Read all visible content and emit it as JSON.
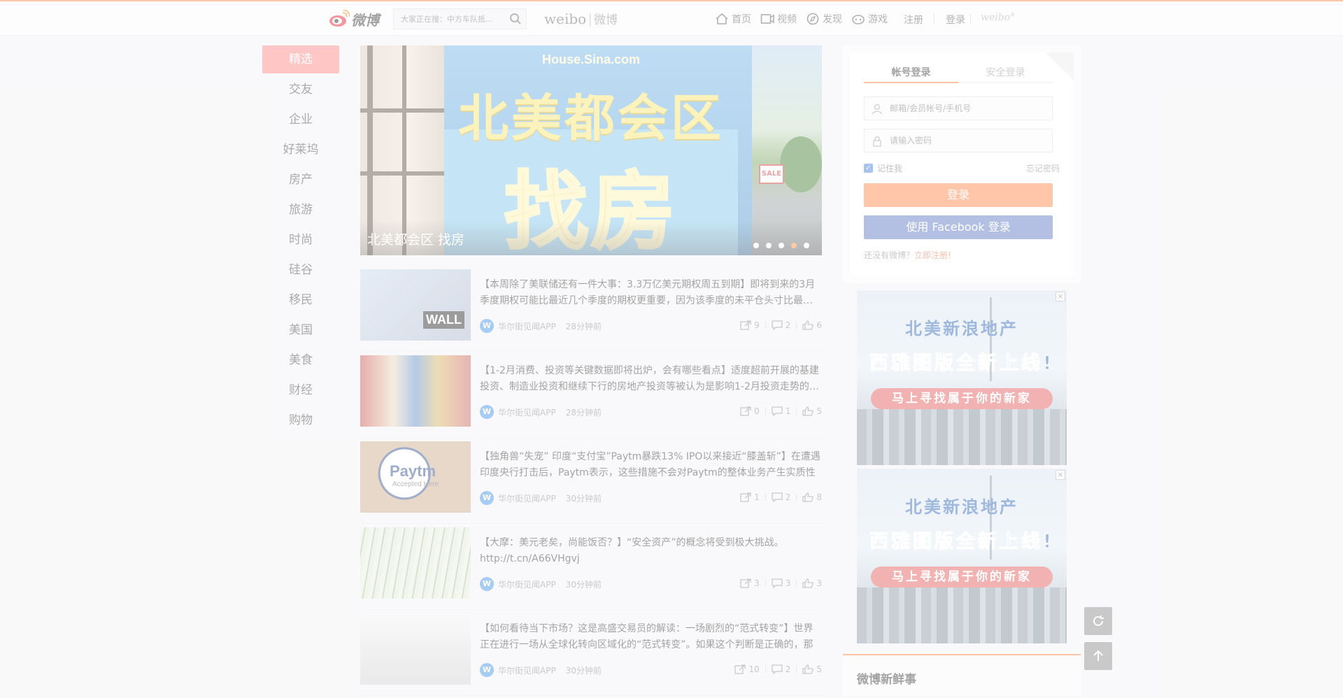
{
  "header": {
    "logo_text": "微博",
    "search_placeholder": "大家正在搜：中方车队抵...",
    "brand_en": "weibo",
    "brand_cn": "微博",
    "nav": [
      {
        "label": "首页",
        "icon": "home-icon"
      },
      {
        "label": "视频",
        "icon": "video-icon"
      },
      {
        "label": "发现",
        "icon": "discover-icon"
      },
      {
        "label": "游戏",
        "icon": "game-icon"
      }
    ],
    "register": "注册",
    "login": "登录",
    "small_logo": "weibo°"
  },
  "leftnav": {
    "items": [
      "精选",
      "交友",
      "企业",
      "好莱坞",
      "房产",
      "旅游",
      "时尚",
      "硅谷",
      "移民",
      "美国",
      "美食",
      "财经",
      "购物"
    ],
    "active_index": 0
  },
  "banner": {
    "site": "House.Sina.com",
    "headline1": "北美都会区",
    "headline2": "找房",
    "sign": "SALE",
    "caption": "北美都会区 找房",
    "slides": 5,
    "active_slide": 3
  },
  "feed": [
    {
      "text": "【本周除了美联储还有一件大事：3.3万亿美元期权周五到期】即将到来的3月季度期权可能比最近几个季度的期权更重要，因为该季度的未平仓头寸比最…",
      "thumb_label": "WALL",
      "source": "华尔街见闻APP",
      "time": "28分钟前",
      "reposts": "9",
      "comments": "2",
      "likes": "6"
    },
    {
      "text": "【1-2月消费、投资等关键数据即将出炉，会有哪些看点】适度超前开展的基建投资、制造业投资和继续下行的房地产投资等被认为是影响1-2月投资走势的…",
      "thumb_label": "",
      "source": "华尔街见闻APP",
      "time": "28分钟前",
      "reposts": "0",
      "comments": "1",
      "likes": "5"
    },
    {
      "text": "【独角兽“失宠” 印度“支付宝”Paytm暴跌13% IPO以来接近“膝盖斩”】在遭遇印度央行打击后，Paytm表示，这些措施不会对Paytm的整体业务产生实质性的…",
      "thumb_label": "Paytm",
      "thumb_sub": "Accepted Here",
      "source": "华尔街见闻APP",
      "time": "30分钟前",
      "reposts": "1",
      "comments": "2",
      "likes": "8"
    },
    {
      "text": "【大摩：美元老矣，尚能饭否？】“安全资产”的概念将受到极大挑战。 http://t.cn/A66VHgvj",
      "thumb_label": "",
      "source": "华尔街见闻APP",
      "time": "30分钟前",
      "reposts": "3",
      "comments": "3",
      "likes": "3"
    },
    {
      "text": "【如何看待当下市场？这是高盛交易员的解读：一场剧烈的“范式转变”】世界正在进行一场从全球化转向区域化的“范式转变”。如果这个判断是正确的，那么…",
      "thumb_label": "",
      "source": "华尔街见闻APP",
      "time": "30分钟前",
      "reposts": "10",
      "comments": "2",
      "likes": "5"
    }
  ],
  "login": {
    "tab_account": "帐号登录",
    "tab_secure": "安全登录",
    "username_placeholder": "邮箱/会员帐号/手机号",
    "password_placeholder": "请输入密码",
    "remember": "记住我",
    "forgot": "忘记密码",
    "login_button": "登录",
    "facebook_button": "使用 Facebook 登录",
    "no_account": "还没有微博？",
    "signup_link": "立即注册!"
  },
  "ads": [
    {
      "line1": "北美新浪地产",
      "line2": "西雅图版全新上线!",
      "cta": "马上寻找属于你的新家"
    },
    {
      "line1": "北美新浪地产",
      "line2": "西雅图版全新上线!",
      "cta": "马上寻找属于你的新家"
    }
  ],
  "news_section_title": "微博新鲜事",
  "colors": {
    "accent": "#fa7d3c",
    "active_nav": "#ff8080",
    "facebook": "#5874c4",
    "link": "#eb7350"
  }
}
